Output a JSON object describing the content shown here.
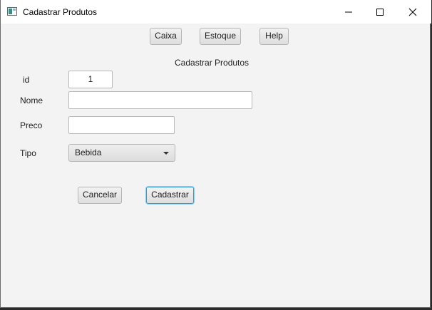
{
  "window": {
    "title": "Cadastrar Produtos",
    "app_icon": "java-window-icon",
    "controls": {
      "minimize_icon": "minimize-icon",
      "maximize_icon": "maximize-icon",
      "close_icon": "close-icon"
    }
  },
  "nav": {
    "caixa": "Caixa",
    "estoque": "Estoque",
    "help": "Help"
  },
  "form": {
    "heading": "Cadastrar Produtos",
    "id_label": "id",
    "id_value": "1",
    "nome_label": "Nome",
    "nome_value": "",
    "preco_label": "Preco",
    "preco_value": "",
    "tipo_label": "Tipo",
    "tipo_selected": "Bebida"
  },
  "actions": {
    "cancel": "Cancelar",
    "submit": "Cadastrar"
  },
  "colors": {
    "background": "#f3f3f3",
    "focus": "#2b9be0"
  }
}
